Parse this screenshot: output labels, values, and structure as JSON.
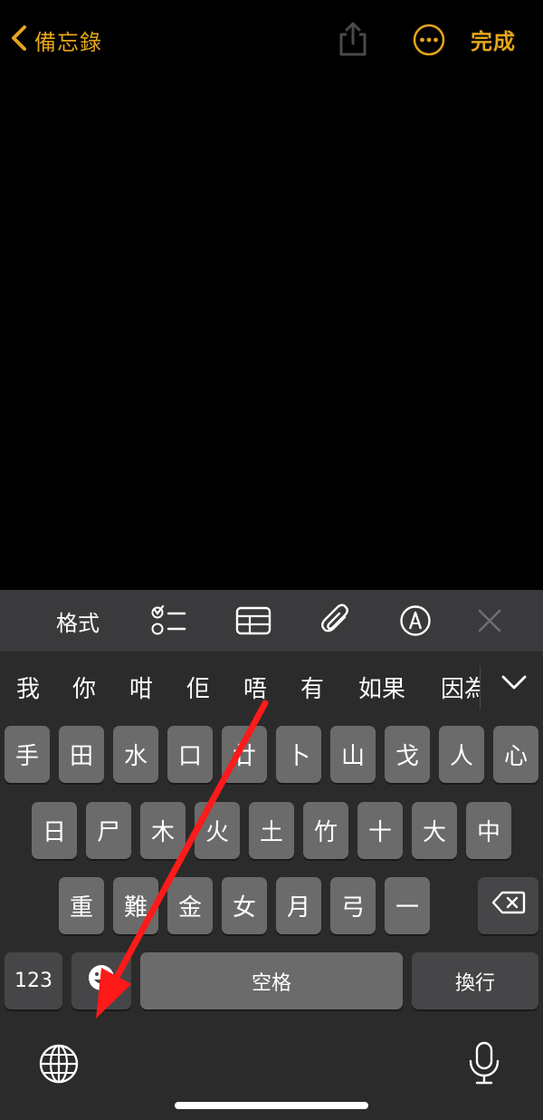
{
  "nav": {
    "back_label": "備忘錄",
    "done_label": "完成",
    "accent_color": "#e6a51a"
  },
  "toolbar": {
    "format_label": "格式",
    "icons": [
      "checklist-icon",
      "table-icon",
      "paperclip-icon",
      "markup-pen-icon",
      "close-icon"
    ]
  },
  "candidates": {
    "items": [
      "我",
      "你",
      "咁",
      "佢",
      "唔",
      "有",
      "如果",
      "因為"
    ],
    "expand_icon": "chevron-down-icon"
  },
  "keyboard": {
    "row1": [
      "手",
      "田",
      "水",
      "口",
      "廿",
      "卜",
      "山",
      "戈",
      "人",
      "心"
    ],
    "row2": [
      "日",
      "尸",
      "木",
      "火",
      "土",
      "竹",
      "十",
      "大",
      "中"
    ],
    "row3": [
      "重",
      "難",
      "金",
      "女",
      "月",
      "弓",
      "一"
    ],
    "numbers_label": "123",
    "space_label": "空格",
    "return_label": "換行",
    "delete_icon": "backspace-icon",
    "emoji_icon": "emoji-icon",
    "globe_icon": "globe-icon",
    "mic_icon": "microphone-icon"
  },
  "annotation": {
    "arrow_color": "#ff1a1a",
    "arrow_icon": "red-arrow-annotation"
  }
}
